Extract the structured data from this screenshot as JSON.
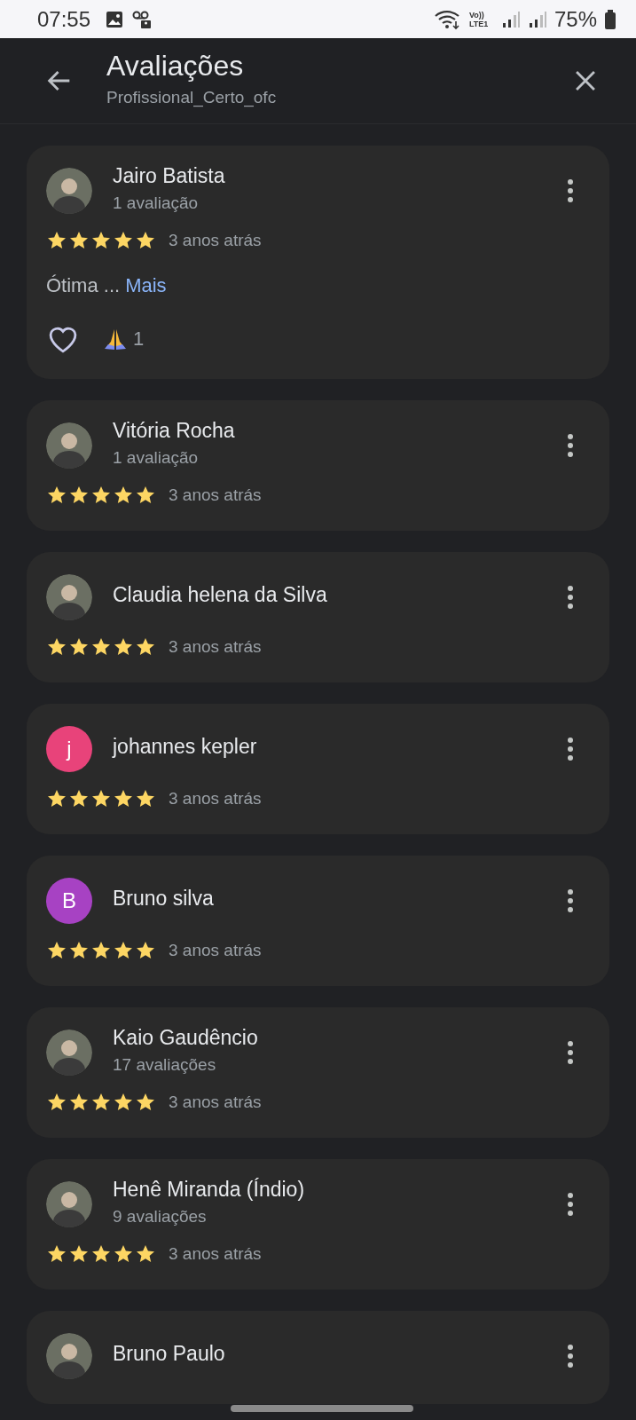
{
  "status_bar": {
    "time": "07:55",
    "network": "Vo)) LTE1",
    "battery": "75%"
  },
  "header": {
    "title": "Avaliações",
    "subtitle": "Profissional_Certo_ofc"
  },
  "reviews": [
    {
      "name": "Jairo Batista",
      "avatar": {
        "kind": "photo"
      },
      "count": "1 avaliação",
      "stars": 5,
      "time": "3 anos atrás",
      "text": "Ótima ...",
      "more": "Mais",
      "liked": false,
      "reaction_count": "1"
    },
    {
      "name": "Vitória Rocha",
      "avatar": {
        "kind": "photo"
      },
      "count": "1 avaliação",
      "stars": 5,
      "time": "3 anos atrás"
    },
    {
      "name": "Claudia helena da Silva",
      "avatar": {
        "kind": "photo"
      },
      "stars": 5,
      "time": "3 anos atrás"
    },
    {
      "name": "johannes kepler",
      "avatar": {
        "kind": "letter",
        "letter": "j",
        "color": "#e8437a"
      },
      "stars": 5,
      "time": "3 anos atrás"
    },
    {
      "name": "Bruno silva",
      "avatar": {
        "kind": "letter",
        "letter": "B",
        "color": "#a742c3"
      },
      "stars": 5,
      "time": "3 anos atrás"
    },
    {
      "name": "Kaio Gaudêncio",
      "avatar": {
        "kind": "photo"
      },
      "count": "17 avaliações",
      "stars": 5,
      "time": "3 anos atrás"
    },
    {
      "name": "Henê Miranda (Índio)",
      "avatar": {
        "kind": "photo"
      },
      "count": "9 avaliações",
      "stars": 5,
      "time": "3 anos atrás"
    },
    {
      "name": "Bruno Paulo",
      "avatar": {
        "kind": "photo"
      }
    }
  ]
}
